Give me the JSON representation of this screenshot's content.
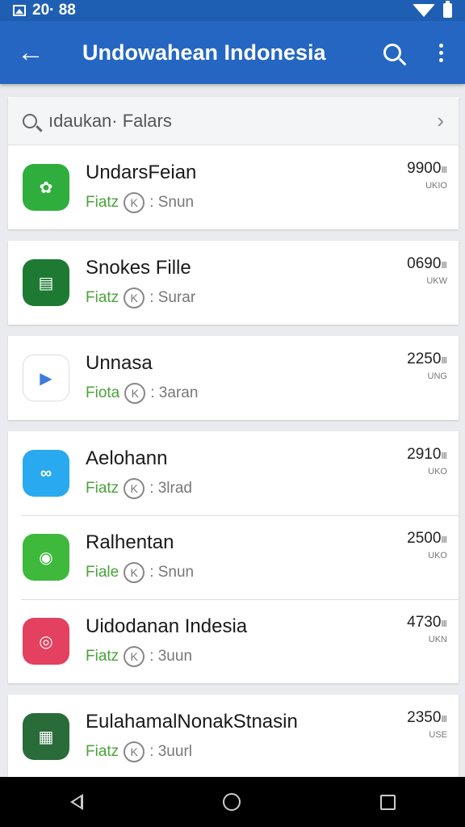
{
  "status_bar": {
    "time": "20· 88"
  },
  "app_bar": {
    "title": "Undowahean Indonesia"
  },
  "search": {
    "text": "ıdaukan· Falars"
  },
  "items": [
    {
      "name": "UndarsFeian",
      "tag": "Fiatz",
      "circle": "K",
      "meta": ": Snun",
      "num": "9900",
      "unit_top": "Ⅲ",
      "unit_bottom": "UKIO",
      "icon_color": "#2fae3d",
      "icon_glyph": "✿",
      "icon_name": "leaf-icon"
    },
    {
      "name": "Snokes Fille",
      "tag": "Fiatz",
      "circle": "K",
      "meta": ": Surar",
      "num": "0690",
      "unit_top": "Ⅲ",
      "unit_bottom": "UKW",
      "icon_color": "#1e7a32",
      "icon_glyph": "▤",
      "icon_name": "clipboard-icon"
    },
    {
      "name": "Unnasa",
      "tag": "Fiota",
      "circle": "K",
      "meta": ": 3aran",
      "num": "2250",
      "unit_top": "Ⅲ",
      "unit_bottom": "UNG",
      "icon_color": "#ffffff",
      "icon_glyph": "▶",
      "icon_name": "play-store-icon"
    },
    {
      "name": "Aelohann",
      "tag": "Fiatz",
      "circle": "K",
      "meta": ": 3lrad",
      "num": "2910",
      "unit_top": "Ⅲ",
      "unit_bottom": "UKO",
      "icon_color": "#29a9f0",
      "icon_glyph": "∞",
      "icon_name": "loop-icon"
    },
    {
      "name": "Ralhentan",
      "tag": "Fiale",
      "circle": "K",
      "meta": ": Snun",
      "num": "2500",
      "unit_top": "Ⅲ",
      "unit_bottom": "UKO",
      "icon_color": "#3eb93c",
      "icon_glyph": "◉",
      "icon_name": "chat-icon"
    },
    {
      "name": "Uidodanan Indesia",
      "tag": "Fiatz",
      "circle": "K",
      "meta": ": 3uun",
      "num": "4730",
      "unit_top": "Ⅲ",
      "unit_bottom": "UKN",
      "icon_color": "#e4405f",
      "icon_glyph": "◎",
      "icon_name": "instagram-icon"
    },
    {
      "name": "EulahamalNonakStnasin",
      "tag": "Fiatz",
      "circle": "K",
      "meta": ": 3uurl",
      "num": "2350",
      "unit_top": "Ⅲ",
      "unit_bottom": "USE",
      "icon_color": "#2a6b3a",
      "icon_glyph": "▦",
      "icon_name": "badge-icon"
    }
  ]
}
